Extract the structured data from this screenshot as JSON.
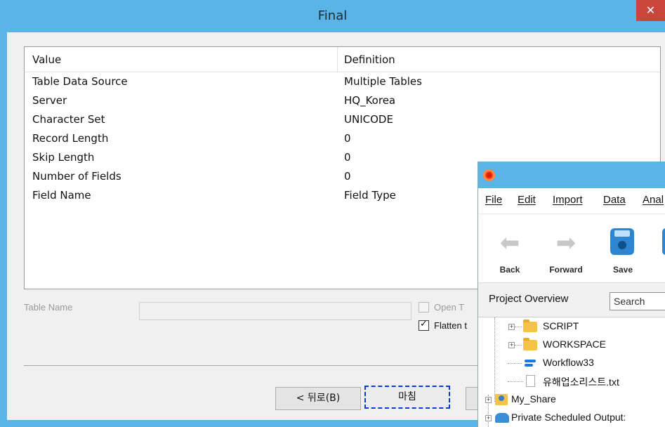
{
  "dialog": {
    "title": "Final",
    "close_glyph": "✕",
    "grid": {
      "columns": [
        "Value",
        "Definition"
      ],
      "rows": [
        {
          "value": "Table Data Source",
          "definition": "Multiple Tables"
        },
        {
          "value": "Server",
          "definition": "HQ_Korea"
        },
        {
          "value": "Character Set",
          "definition": "UNICODE"
        },
        {
          "value": "Record Length",
          "definition": "0"
        },
        {
          "value": "Skip Length",
          "definition": "0"
        },
        {
          "value": "Number of Fields",
          "definition": "0"
        },
        {
          "value": "Field Name",
          "definition": "Field Type"
        }
      ]
    },
    "table_name_label": "Table Name",
    "table_name_value": "",
    "open_table_label": "Open T",
    "open_table_checked": false,
    "flatten_label": "Flatten t",
    "flatten_checked": true,
    "buttons": {
      "back": "< 뒤로(B)",
      "finish": "마침"
    }
  },
  "app": {
    "logo_icon": "app-logo-icon",
    "menu": [
      "File",
      "Edit",
      "Import",
      "Data",
      "Anal"
    ],
    "toolbar": [
      {
        "label": "Back",
        "icon": "arrow-left-icon",
        "glyph": "⬅"
      },
      {
        "label": "Forward",
        "icon": "arrow-right-icon",
        "glyph": "➡"
      },
      {
        "label": "Save",
        "icon": "save-icon"
      }
    ],
    "project_overview_label": "Project Overview",
    "search_placeholder": "Search",
    "tree": [
      {
        "label": "SCRIPT",
        "icon": "folder-icon",
        "expandable": true
      },
      {
        "label": "WORKSPACE",
        "icon": "folder-icon",
        "expandable": true
      },
      {
        "label": "Workflow33",
        "icon": "workflow-icon",
        "expandable": false
      },
      {
        "label": "유해업소리스트.txt",
        "icon": "document-icon",
        "expandable": false
      },
      {
        "label": "My_Share",
        "icon": "shared-folder-icon",
        "expandable": true
      },
      {
        "label": "Private Scheduled Output:",
        "icon": "cloud-folder-icon",
        "expandable": true
      }
    ]
  },
  "colors": {
    "titlebar": "#5ab4e6",
    "close": "#c8463c",
    "focus_border": "#0c3ad8",
    "save_icon": "#2f86d0",
    "folder": "#f5c24a"
  }
}
